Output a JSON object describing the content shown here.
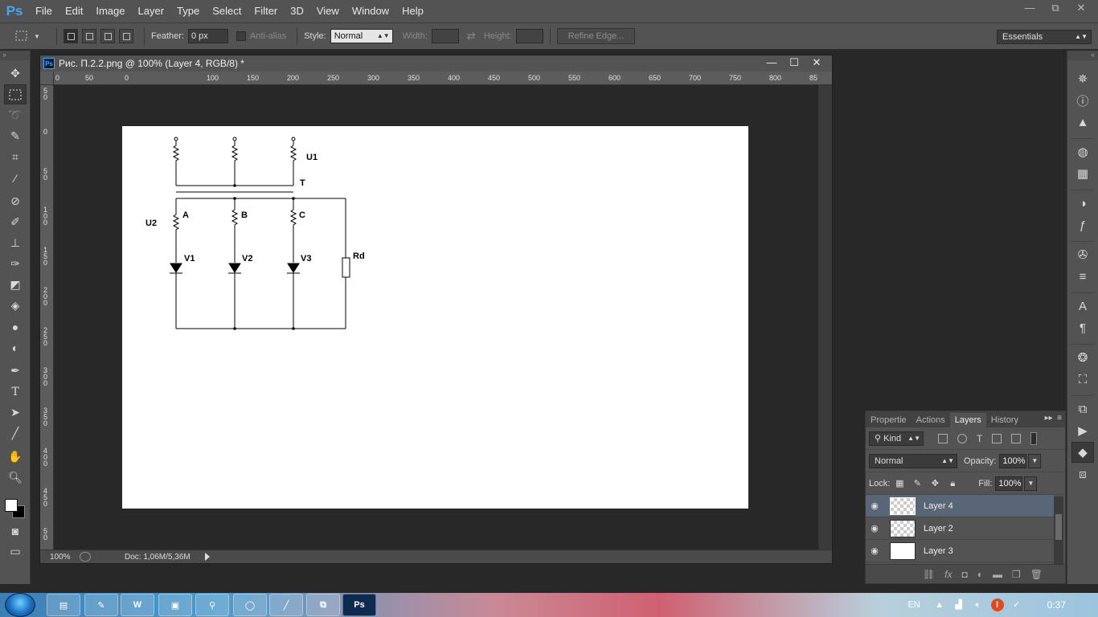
{
  "app": {
    "logo": "Ps"
  },
  "menu": [
    "File",
    "Edit",
    "Image",
    "Layer",
    "Type",
    "Select",
    "Filter",
    "3D",
    "View",
    "Window",
    "Help"
  ],
  "window_controls": {
    "minimize": "—",
    "restore": "⧉",
    "close": "✕"
  },
  "options": {
    "feather_label": "Feather:",
    "feather_value": "0 px",
    "antialias_label": "Anti-alias",
    "style_label": "Style:",
    "style_value": "Normal",
    "width_label": "Width:",
    "height_label": "Height:",
    "refine_edge": "Refine Edge...",
    "workspace": "Essentials"
  },
  "document": {
    "title": "Рис. П.2.2.png @ 100% (Layer 4, RGB/8) *",
    "zoom": "100%",
    "doc_size": "Doc: 1,06M/5,36M",
    "ruler_h": [
      "0",
      "50",
      "0",
      "100",
      "150",
      "200",
      "250",
      "300",
      "350",
      "400",
      "450",
      "500",
      "550",
      "600",
      "650",
      "700",
      "750",
      "800",
      "85"
    ],
    "ruler_v": [
      "5 0",
      "0",
      "5 0",
      "1 0 0",
      "1 5 0",
      "2 0 0",
      "2 5 0",
      "3 0 0",
      "3 5 0",
      "4 0 0",
      "4 5 0",
      "5 0"
    ]
  },
  "circuit": {
    "labels": {
      "u1": "U1",
      "t": "T",
      "u2": "U2",
      "a": "A",
      "b": "B",
      "c": "C",
      "v1": "V1",
      "v2": "V2",
      "v3": "V3",
      "rd": "Rd"
    }
  },
  "layers_panel": {
    "tabs": [
      "Propertie",
      "Actions",
      "Layers",
      "History"
    ],
    "active_tab": "Layers",
    "filter_kind": "Kind",
    "blend_mode": "Normal",
    "opacity_label": "Opacity:",
    "opacity": "100%",
    "lock_label": "Lock:",
    "fill_label": "Fill:",
    "fill": "100%",
    "layers": [
      {
        "name": "Layer 4",
        "selected": true,
        "thumb": "transparent"
      },
      {
        "name": "Layer 2",
        "selected": false,
        "thumb": "transparent"
      },
      {
        "name": "Layer 3",
        "selected": false,
        "thumb": "white"
      }
    ]
  },
  "taskbar": {
    "apps": [
      "explorer-icon",
      "notepad-icon",
      "word-icon",
      "window-icon",
      "search-icon",
      "opera-icon",
      "pen-icon",
      "network-icon",
      "photoshop-icon"
    ],
    "lang": "EN",
    "clock": "0:37"
  }
}
